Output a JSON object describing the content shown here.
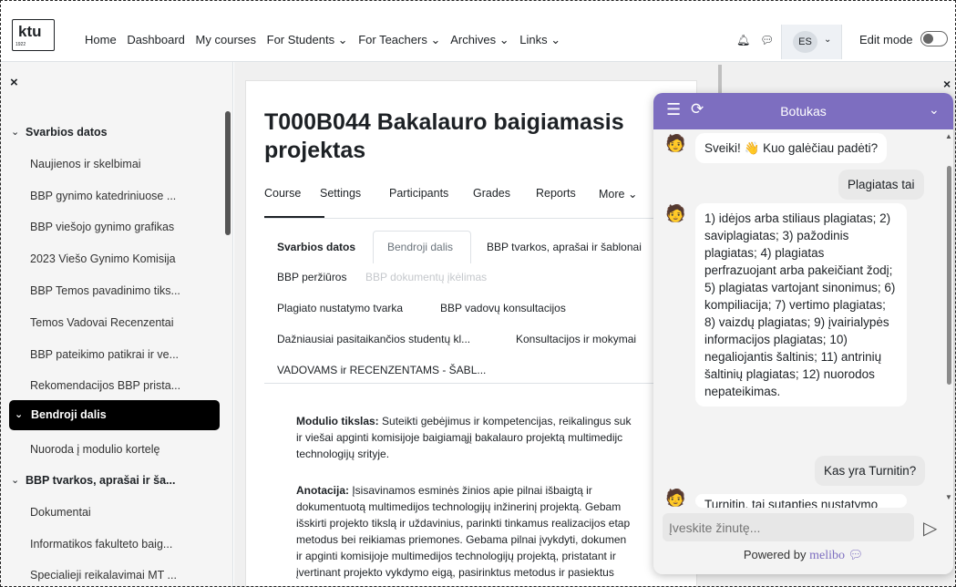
{
  "logo": {
    "text": "ktu",
    "year": "1922"
  },
  "nav": {
    "links": [
      "Home",
      "Dashboard",
      "My courses",
      "For Students ⌄",
      "For Teachers ⌄",
      "Archives ⌄",
      "Links ⌄"
    ],
    "avatar": "ES",
    "edit_mode": "Edit mode"
  },
  "drawer": {
    "close": "×",
    "sections": [
      {
        "title": "Svarbios datos",
        "items": [
          "Naujienos ir skelbimai",
          "BBP gynimo katedriniuose ...",
          "BBP viešojo gynimo grafikas",
          "2023 Viešo Gynimo Komisija",
          "BBP Temos pavadinimo tiks...",
          "Temos Vadovai Recenzentai",
          "BBP pateikimo patikrai ir ve...",
          "Rekomendacijos BBP prista..."
        ]
      },
      {
        "title": "Bendroji dalis",
        "items": [
          "Nuoroda į modulio kortelę"
        ]
      },
      {
        "title": "BBP tvarkos, aprašai ir ša...",
        "items": [
          "Dokumentai",
          "Informatikos fakulteto baig...",
          "Specialieji reikalavimai MT ..."
        ]
      }
    ]
  },
  "course": {
    "title": "T000B044 Bakalauro baigiamasis projektas",
    "tabs": [
      "Course",
      "Settings",
      "Participants",
      "Grades",
      "Reports",
      "More ⌄"
    ],
    "subtabs": {
      "row1": [
        "Svarbios datos",
        "Bendroji dalis",
        "BBP tvarkos, aprašai ir šablonai"
      ],
      "row2": [
        "BBP peržiūros",
        "BBP dokumentų įkėlimas"
      ],
      "row3": [
        "Plagiato nustatymo tvarka",
        "BBP vadovų konsultacijos"
      ],
      "row4": [
        "Dažniausiai pasitaikančios studentų kl...",
        "Konsultacijos ir mokymai"
      ],
      "row5": [
        "VADOVAMS ir RECENZENTAMS - ŠABL..."
      ]
    },
    "goal_label": "Modulio tikslas:",
    "goal_text": " Suteikti gebėjimus ir kompetencijas, reikalingus suk",
    "goal_line2": "ir viešai apginti komisijoje baigiamąjį bakalauro projektą multimedijc",
    "goal_line3": "technologijų srityje.",
    "annot_label": "Anotacija:",
    "annot_text": " Įsisavinamos esminės žinios apie pilnai išbaigtą ir",
    "annot_line2": "dokumentuotą multimedijos technologijų inžinerinį projektą. Gebam",
    "annot_line3": "išskirti projekto tikslą ir uždavinius, parinkti tinkamus realizacijos etap",
    "annot_line4": "metodus bei reikiamas priemones. Gebama pilnai įvykdyti, dokumen",
    "annot_line5": "ir apginti komisijoje multimedijos technologijų projektą, pristatant ir",
    "annot_line6": "įvertinant projekto vykdymo eigą, pasirinktus metodus ir pasiektus"
  },
  "chat": {
    "title": "Botukas",
    "menu_icon": "☰",
    "refresh_icon": "⟳",
    "collapse_icon": "⌄",
    "msg_greeting": "Sveiki! 👋 Kuo galėčiau padėti?",
    "msg_user1": "Plagiatas tai",
    "msg_bot1": "1) idėjos arba stiliaus plagiatas; 2) saviplagiatas; 3) pažodinis plagiatas; 4) plagiatas perfrazuojant arba pakeičiant žodį; 5) plagiatas vartojant sinonimus; 6) kompiliacija; 7) vertimo plagiatas; 8) vaizdų plagiatas; 9) įvairialypės informacijos plagiatas; 10) negaliojantis šaltinis; 11) antrinių šaltinių plagiatas; 12) nuorodos nepateikimas.",
    "msg_user2": "Kas yra Turnitin?",
    "msg_bot2_partial": "Turnitin, tai sutapties nustatymo",
    "input_placeholder": "Įveskite žinutę...",
    "powered_by": "Powered by",
    "brand": "melibo"
  }
}
